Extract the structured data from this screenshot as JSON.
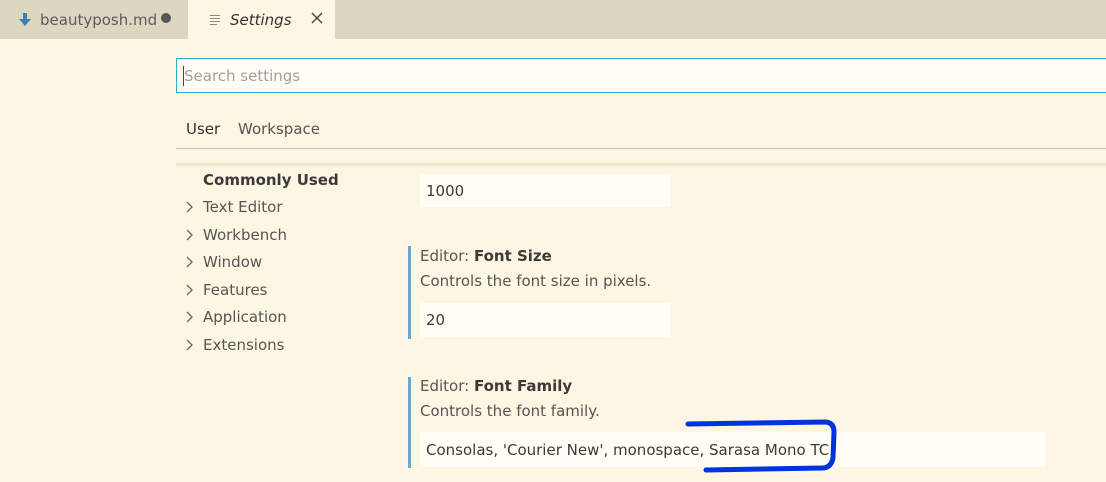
{
  "tabs": [
    {
      "label": "beautyposh.md",
      "icon": "markdown-arrow-down-icon",
      "dirty": true
    },
    {
      "label": "Settings",
      "icon": "settings-lines-icon",
      "active": true
    }
  ],
  "search": {
    "placeholder": "Search settings"
  },
  "scopes": [
    "User",
    "Workspace"
  ],
  "toc": {
    "commonly_used": "Commonly Used",
    "items": [
      "Text Editor",
      "Workbench",
      "Window",
      "Features",
      "Application",
      "Extensions"
    ]
  },
  "settings": {
    "prev_value": "1000",
    "font_size": {
      "category": "Editor: ",
      "name": "Font Size",
      "description": "Controls the font size in pixels.",
      "value": "20"
    },
    "font_family": {
      "category": "Editor: ",
      "name": "Font Family",
      "description": "Controls the font family.",
      "value": "Consolas, 'Courier New', monospace, Sarasa Mono TC"
    }
  },
  "colors": {
    "tabbar": "#ddd6c1",
    "background": "#fdf6e3",
    "accent": "#2ab0c4",
    "setting_bar": "#69a9d6",
    "annotation": "#0033dd"
  }
}
